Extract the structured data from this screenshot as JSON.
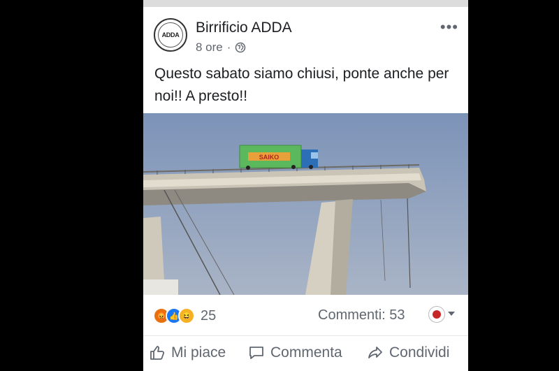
{
  "post": {
    "page_name": "Birrificio ADDA",
    "avatar_text": "ADDA",
    "time": "8 ore",
    "separator": "·",
    "privacy_icon": "globe-icon",
    "more_icon": "•••",
    "text": "Questo sabato siamo chiusi, ponte anche per noi!! A presto!!",
    "truck_label": "SAIKO",
    "reactions": [
      "angry",
      "like",
      "haha"
    ],
    "reaction_count": "25",
    "comments_label": "Commenti: 53"
  },
  "actions": {
    "like_label": "Mi piace",
    "comment_label": "Commenta",
    "share_label": "Condividi"
  },
  "colors": {
    "sky": "#7f95b8",
    "truck_green": "#5cb85c",
    "truck_cab": "#2c6fb7",
    "text": "#1c1e21",
    "secondary": "#606770"
  }
}
